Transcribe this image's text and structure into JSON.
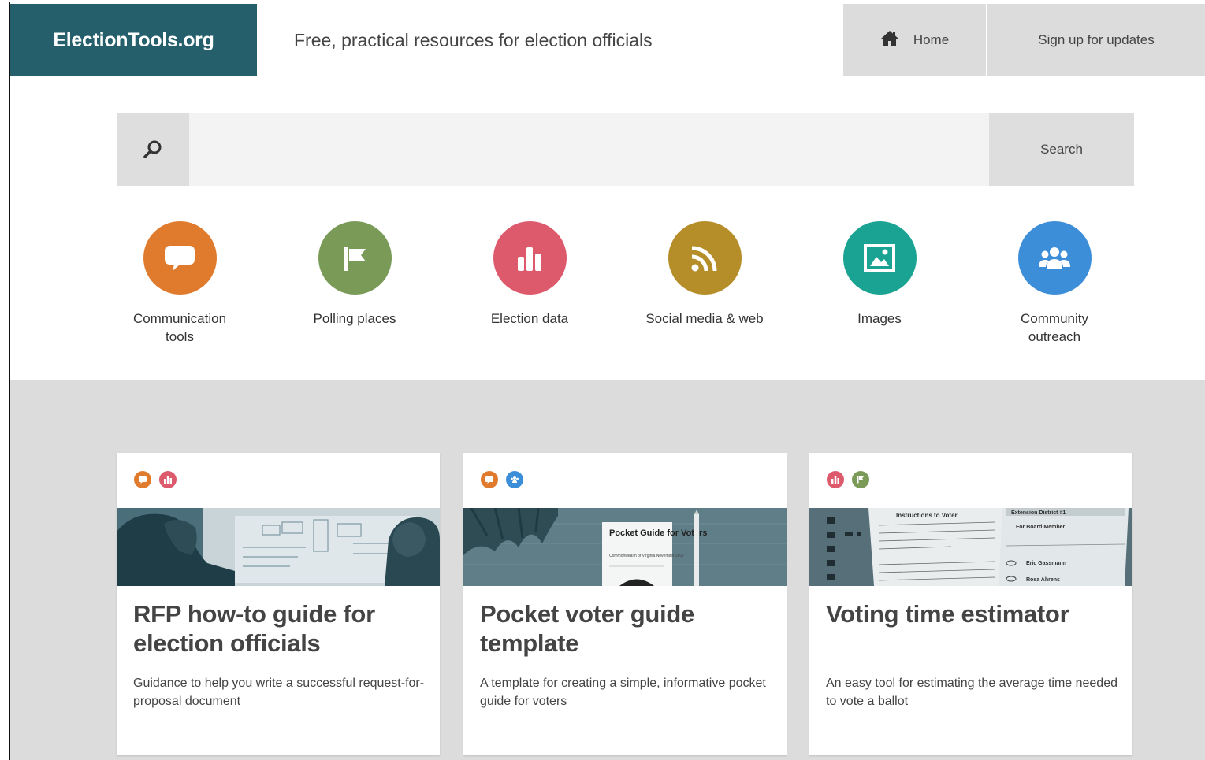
{
  "header": {
    "brand": "ElectionTools.org",
    "tagline": "Free, practical resources for election officials",
    "nav_home": "Home",
    "nav_signup": "Sign up for updates"
  },
  "search": {
    "placeholder": "",
    "button_label": "Search"
  },
  "categories": [
    {
      "label": "Communication tools",
      "color": "#e07b2e",
      "icon": "speech-bubble-icon"
    },
    {
      "label": "Polling places",
      "color": "#7a9a57",
      "icon": "flag-icon"
    },
    {
      "label": "Election data",
      "color": "#dd5a6c",
      "icon": "bar-chart-icon"
    },
    {
      "label": "Social media & web",
      "color": "#b58e2a",
      "icon": "rss-icon"
    },
    {
      "label": "Images",
      "color": "#1aa392",
      "icon": "image-icon"
    },
    {
      "label": "Community outreach",
      "color": "#3d8ed8",
      "icon": "people-icon"
    }
  ],
  "cards": [
    {
      "title": "RFP how-to guide for election officials",
      "description": "Guidance to help you write a successful request-for-proposal document",
      "tags": [
        "communication",
        "election-data"
      ]
    },
    {
      "title": "Pocket voter guide template",
      "description": "A template for creating a simple, informative pocket guide for voters",
      "tags": [
        "communication",
        "community-outreach"
      ],
      "image_text": {
        "title": "Pocket Guide for Voters",
        "sub": "Commonwealth of Virginia November 2017"
      }
    },
    {
      "title": "Voting time estimator",
      "description": "An easy tool for estimating the average time needed to vote a ballot",
      "tags": [
        "election-data",
        "polling-places"
      ],
      "image_text": {
        "instructions": "Instructions to Voter",
        "district": "Extension District #1",
        "board": "For Board Member",
        "name1": "Eric Gassmann",
        "name2": "Rosa Ahrens"
      }
    }
  ]
}
